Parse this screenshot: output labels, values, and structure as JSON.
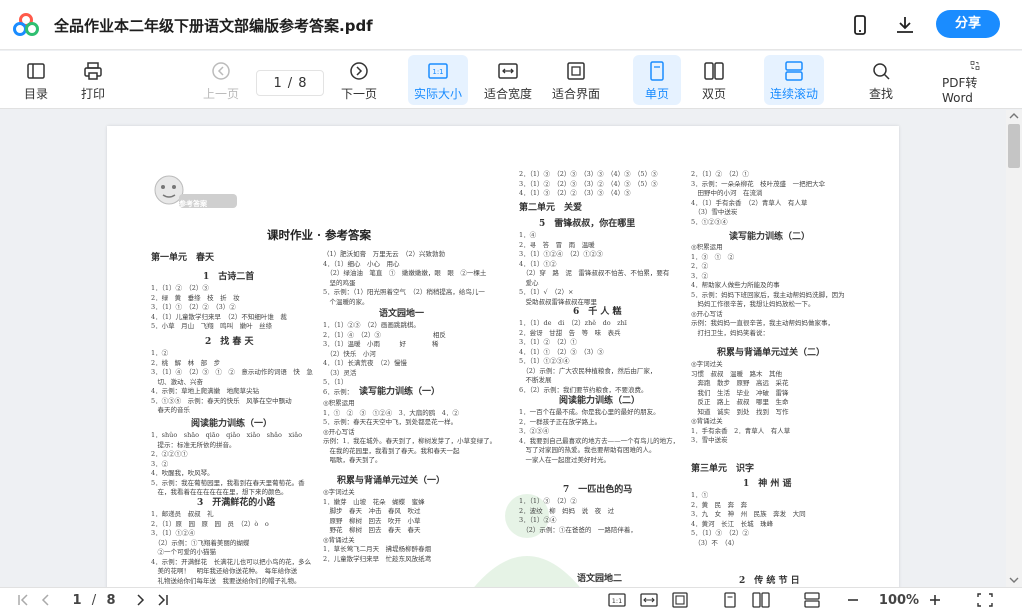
{
  "app": {
    "file_title": "全品作业本二年级下册语文部编版参考答案.pdf",
    "share_label": "分享"
  },
  "toolbar": {
    "toc": "目录",
    "print": "打印",
    "prev_page": "上一页",
    "current_page": "1",
    "page_sep": "/",
    "total_pages": "8",
    "next_page": "下一页",
    "actual_size": "实际大小",
    "fit_width": "适合宽度",
    "fit_page": "适合界面",
    "single_page": "单页",
    "double_page": "双页",
    "continuous_scroll": "连续滚动",
    "search": "查找",
    "pdf_to_word": "PDF转Word",
    "actual_size_icon_text": "1:1"
  },
  "statusbar": {
    "current_page": "1",
    "sep": "/",
    "total_pages": "8",
    "zoom": "100%",
    "actual_icon_text": "1:1"
  },
  "doc": {
    "badge": "参考答案",
    "main_title": "课时作业 · 参考答案",
    "col1": {
      "unit": "第一单元　春天",
      "lesson1": "1　古诗二首",
      "l1": [
        "1．（1）②　（2）③",
        "2．绿　黄　垂绦　枝　折　妆",
        "3．（1）①　（2）②　（3）②",
        "4．（1）儿童散学归来早　（2）不知细叶谁　裁",
        "5．小草　月山　飞翔　鸣叫　嫩叶　丝绦"
      ],
      "lesson2": "2　找 春 天",
      "l2": [
        "1．②",
        "2．桃　解　林　部　步",
        "3．（1）④　（2）③　①　②　意示动作的词语　快　急",
        "　切、激动、兴奋",
        "4．示例：草地上爬满嫩　地爬草尖钻",
        "5．①③⑤　示例：春天的快乐　风筝在空中飘动",
        "　春天的音乐"
      ],
      "read1": "阅读能力训练（一）",
      "r1": [
        "1．shǔo　shāo　qiāo　qiǎo　xiǎo　shǎo　xiǎo",
        "　提示：标准无所依的拼音。",
        "2．②②①①",
        "3．②",
        "4．吹醒我，吹风琴。",
        "5．示例：我在葡萄园里，我看到在春天里葡萄花。香",
        "　在，我看着在在在在在在里，想下来的颜色。"
      ],
      "lesson3": "3　开满鲜花的小路",
      "l3": [
        "1．邮递员　叔叔　礼",
        "2．（1）原　园　原　园　员　（2）ò　o",
        "3．（1）①②④",
        "　（2）示例：①飞翔着美丽的蝴蝶",
        "　②一个可爱的小猫猫",
        "4．示例：开满鲜花　长满花儿也可以把小鸟的花，多么",
        "　美的花啊！　明年我还给你送花种。　每年给你送",
        "　礼物送给你们每年送　我要送给你们的帽子礼物。"
      ]
    },
    "col2": {
      "top": [
        "（1）肥沃如膏　万里无云　（2）兴致勃勃",
        "4．（1）细心　小心　用心",
        "　（2）绿油油　笔直　①　嫩嫩嫩嫩，眼　眼　②一棵土",
        "　坚的鸡蛋",
        "5．示例：（1）阳光照着空气　（2）稍稍提高，给鸟儿一",
        "　个温暖的家。"
      ],
      "garden1": "语文园地一",
      "g1": [
        "1．（1）②③　（2）画画跳跳棋。",
        "2．（1）④　（2）③　　　　　　　　相反",
        "3．（1）温暖　小雨　　　好　　　　稀　　　　",
        "　（2）快乐　小河　　　　　　　　　　　",
        "4．（1）长满荒夜　（2）慢慢　　　",
        "　（3）灵活　　　　　　　　　　　",
        "5．（1）　　　　　　　　　　　　",
        "6．示例：　　　　　　　　　　　　"
      ],
      "read2": "读写能力训练（一）",
      "r2": [
        "◎积累运用",
        "1．①　②　③　①②④　3．大扇的鸥　4．②",
        "5．示例：春天在天空中飞，到处都是花一样。",
        "◎开心写话",
        "示例：1．我在城外。春天到了，柳树发芽了，小草变绿了。",
        "　在我的花园里，我看到了春天。我和春天一起",
        "　唱歌，春天到了。"
      ],
      "unit_test": "积累与背诵单元过关（一）",
      "ut": [
        "◎字词过关",
        "1．嫩芽　山坡　花朵　蝴蝶　蜜蜂",
        "　脚步　春天　冲击　春风　吹过",
        "　原野　柳树　回去　吹开　小草",
        "　野花　柳树　回去　春天　春天",
        "◎背诵过关",
        "1．草长莺飞二月天　拂堤杨柳醉春烟",
        "2．儿童散学归来早　忙趁东风放纸鸢"
      ]
    },
    "col3": {
      "top": [
        "2．（1）③　（2）③　（3）③　（4）③　（5）③",
        "3．（1）②　（2）③　（3）②　（4）③　（5）③",
        "4．（1）③　（2）②　（3）③　（4）③"
      ],
      "unit2": "第二单元　关爱",
      "lesson5": "5　雷锋叔叔，你在哪里",
      "l5": [
        "1．④",
        "2．寻　答　冒　雨　温暖",
        "3．（1）①②④　（2）①②③",
        "4．（1）①②",
        "　（2）穿　路　泥　雷锋叔叔不怕苦、不怕累，要有",
        "　爱心",
        "5．（1）√　（2）×",
        "　受助叔叔雷锋叔叔在哪里"
      ],
      "lesson6": "6　千 人 糕",
      "l6": [
        "1．（1）de　di　（2）zhě　do　zhī",
        "2．尝讶　甘甜　告　等　味　表兵",
        "3．（1）②　（2）①",
        "4．（1）①　（2）③　（3）③",
        "5．（1）①②③④",
        "　（2）示例：广大农民种植粮食，然后由厂家，",
        "　不断发展",
        "6．（2）示例：我们要节约粮食，不要浪费。"
      ],
      "read3": "阅读能力训练（二）",
      "r3": [
        "1．一百个在最不成。你是我心里的最好的朋友。",
        "2．一群孩子正在放学路上。",
        "3．②③④",
        "4．我要到自己最喜欢的地方去——一个有鸟儿的地方，",
        "　写了对家园的热爱。我也要帮助有困难的人。",
        "　一家人在一起度过美好时光。"
      ],
      "lesson7": "7　一匹出色的马",
      "l7": [
        "1．（1）③　（2）②",
        "2．波纹　柳　妈妈　说　夜　过",
        "3．（1）②④",
        "　（2）示例：①在爸爸的　一路陪伴着，"
      ],
      "garden2": "语文园地二"
    },
    "col4": {
      "top": [
        "2．（1）②　（2）①",
        "3．示例：一朵朵柳花　枝叶茂盛　一把把大伞",
        "　田野中的小河　在流淌",
        "4．（1）手有余香　（2）青草人　有人草",
        "　（3）雪中送炭",
        "5．①②③④"
      ],
      "read4": "读写能力训练（二）",
      "r4": [
        "◎积累运用",
        "1．③　①　②",
        "2．②",
        "3．②",
        "4．帮助家人做些力所能及的事",
        "5．示例：妈妈下班回家后，我主动帮妈妈洗脚，因为",
        "　妈妈工作很辛苦，我想让妈妈放松一下。",
        "◎开心写话",
        "示例：我妈妈一直很辛苦，我主动帮妈妈做家事，",
        "　打扫卫生，妈妈笑着说："
      ],
      "unit_test2": "积累与背诵单元过关（二）",
      "ut2": [
        "◎字词过关",
        "习惯　叔叔　温暖　路木　其他",
        "　奔跑　散步　原野　高远　采花",
        "　我们　生活　毕业　冲破　雷锋",
        "　反正　路上　叔叔　哪里　生命",
        "　知道　诚实　到处　找到　写作",
        "◎背诵过关",
        "1．手有余香　2．青草人　有人草",
        "3．雪中送炭"
      ],
      "unit3": "第三单元　识字",
      "lesson_a": "1　神 州 谣",
      "la": [
        "1．①",
        "2．黄　民　奔　奔",
        "3．九　女　神　州　民族　奔发　大同",
        "4．黄河　长江　长城　珠峰",
        "5．（1）③　（2）②",
        "　（3）不　（4）"
      ],
      "lesson_b": "2　传 统 节 日"
    }
  }
}
